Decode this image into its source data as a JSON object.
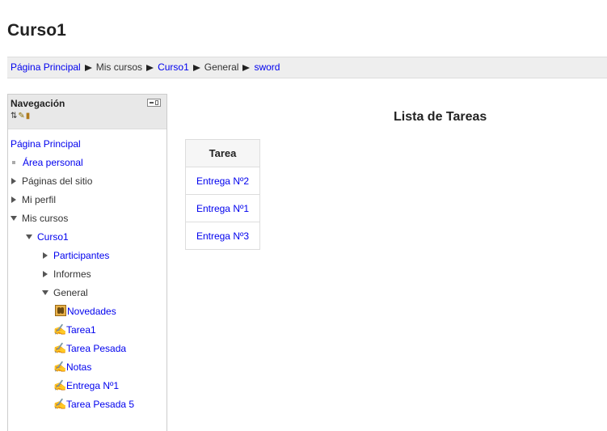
{
  "header": {
    "title": "Curso1"
  },
  "breadcrumb": {
    "items": [
      {
        "label": "Página Principal",
        "link": true
      },
      {
        "label": "Mis cursos",
        "link": false
      },
      {
        "label": "Curso1",
        "link": true
      },
      {
        "label": "General",
        "link": false
      },
      {
        "label": "sword",
        "link": true
      }
    ]
  },
  "navigation": {
    "title": "Navegación",
    "items": [
      {
        "label": "Página Principal"
      },
      {
        "label": "Área personal"
      },
      {
        "label": "Páginas del sitio"
      },
      {
        "label": "Mi perfil"
      },
      {
        "label": "Mis cursos"
      },
      {
        "label": "Curso1"
      },
      {
        "label": "Participantes"
      },
      {
        "label": "Informes"
      },
      {
        "label": "General"
      },
      {
        "label": "Novedades"
      },
      {
        "label": "Tarea1"
      },
      {
        "label": "Tarea Pesada"
      },
      {
        "label": "Notas"
      },
      {
        "label": "Entrega Nº1"
      },
      {
        "label": "Tarea Pesada 5"
      }
    ]
  },
  "main": {
    "title": "Lista de Tareas",
    "table": {
      "header": "Tarea",
      "rows": [
        "Entrega Nº2",
        "Entrega Nº1",
        "Entrega Nº3"
      ]
    }
  },
  "colors": {
    "link": "#0000ee",
    "breadcrumb_bg": "#eeeeee",
    "nav_header_bg": "#e8e8e8"
  }
}
